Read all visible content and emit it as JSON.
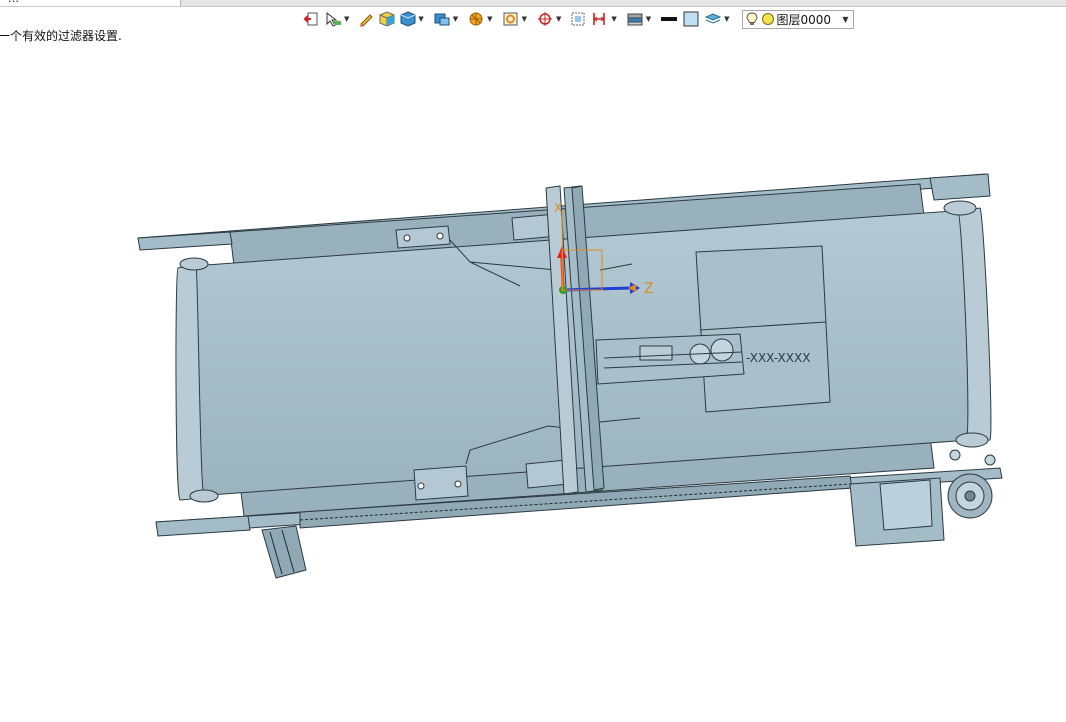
{
  "window": {
    "tab_label": "…"
  },
  "toolbar": {
    "layer": {
      "value": "图层0000"
    }
  },
  "status": {
    "message": "一个有效的过滤器设置."
  },
  "viewport": {
    "axis_z_label": "Z",
    "axis_x_label": "X",
    "part_label": "-XXX-XXXX"
  },
  "colors": {
    "model_fill": "#a3bcc8",
    "model_edge": "#2c3a42",
    "axis_red": "#e02020",
    "axis_blue": "#1f3fd6",
    "axis_green": "#2aa02a",
    "axis_orange": "#e08a1e"
  }
}
